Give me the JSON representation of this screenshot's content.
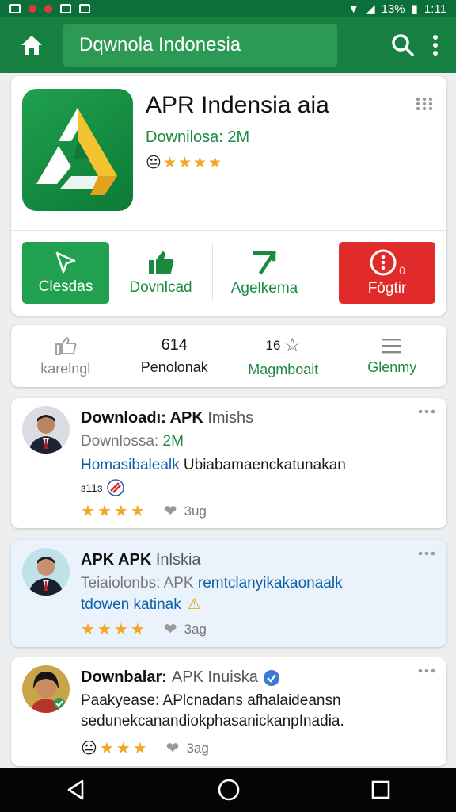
{
  "status_bar": {
    "battery": "13%",
    "time": "1:11"
  },
  "app_bar": {
    "search_text": "Dqwnola Indonesia"
  },
  "app": {
    "title": "APR Indensia aia",
    "downloads": "Downilosa: 2M",
    "rating_stars": 4
  },
  "actions": [
    {
      "label": "Clesdas"
    },
    {
      "label": "Dovnlcad"
    },
    {
      "label": "Agelkema"
    },
    {
      "label": "Fǒgtir",
      "badge": "0"
    }
  ],
  "stats": [
    {
      "label": "karelngl"
    },
    {
      "value": "614",
      "label": "Penolonak"
    },
    {
      "value": "16",
      "label": "Magmboait"
    },
    {
      "label": "Glenmy"
    }
  ],
  "reviews": [
    {
      "title_bold": "Downloadı: APK",
      "title_rest": "Imishs",
      "downloads_prefix": "Downlossa:",
      "downloads_value": "2M",
      "line_blue": "Homasibalealk",
      "line_rest": "Ubiabamaenckatunakan",
      "meta": "ɜ11ɜ",
      "stars": 4,
      "likes": "3ug"
    },
    {
      "title_bold": "APK APK",
      "title_rest": "Inlskia",
      "line1_prefix": "Teiaiolonbs: APK",
      "line1_blue": "remtclanyikakaonaalk",
      "line2_blue": "tdowen katinak",
      "stars": 4,
      "likes": "3ag"
    },
    {
      "title_bold": "Downbalar:",
      "title_rest": "APK Inuiska",
      "line1": "Paakyease: APlcnadans afhalaideansn",
      "line2": "sedunekcanandiokphasanickanpInadia.",
      "stars": 3,
      "likes": "3ag"
    }
  ]
}
